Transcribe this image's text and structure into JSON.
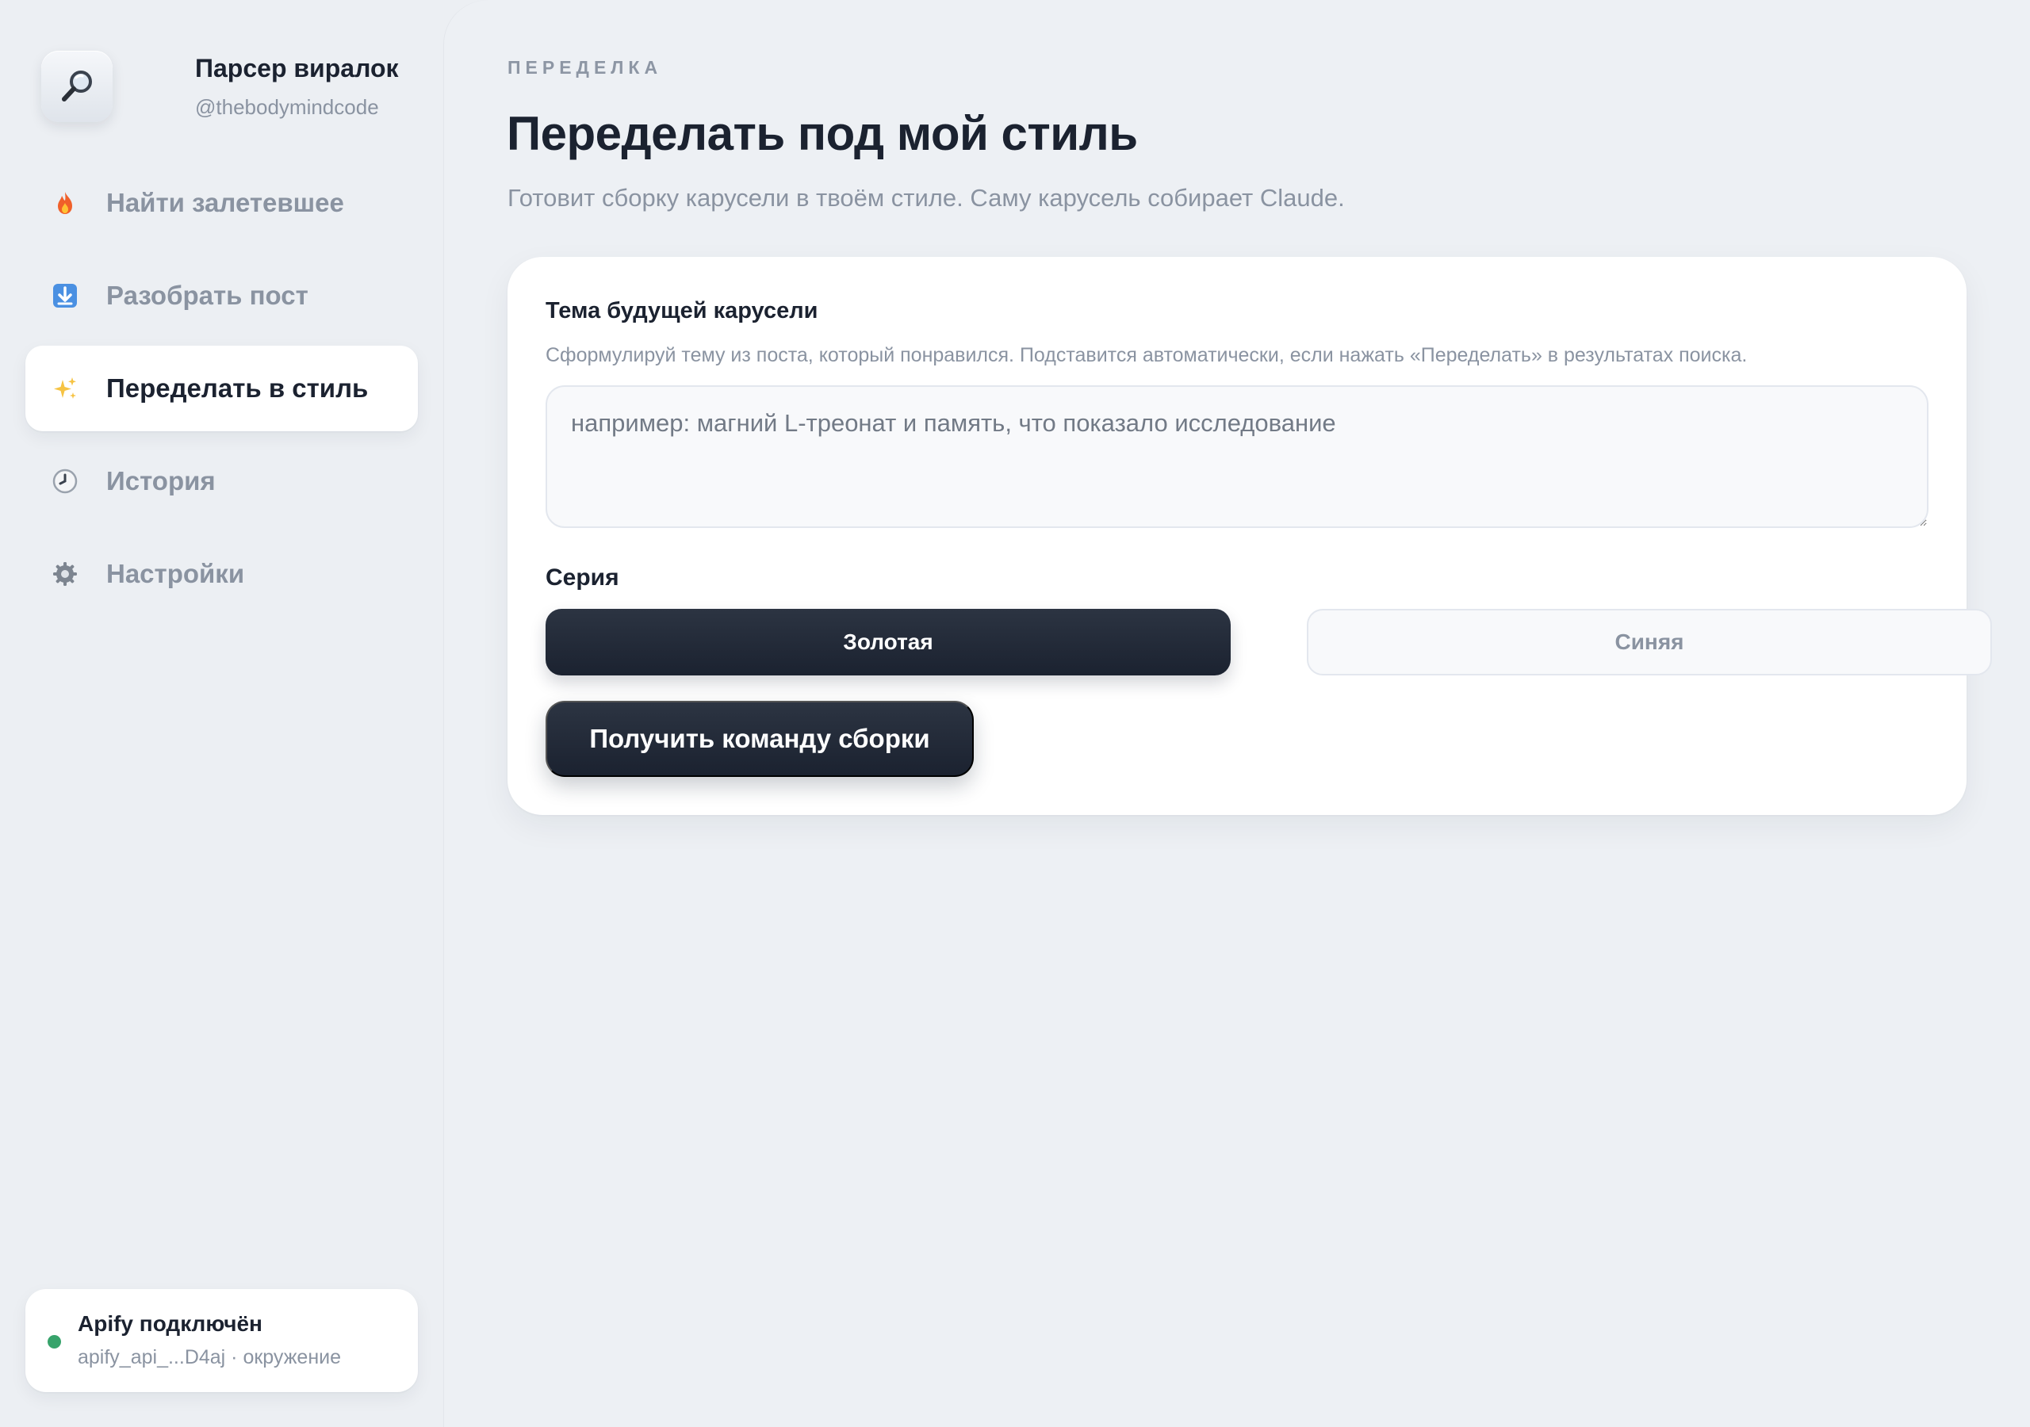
{
  "brand": {
    "title": "Парсер виралок",
    "handle": "@thebodymindcode",
    "logo_icon": "magnifier-icon"
  },
  "sidebar": {
    "items": [
      {
        "label": "Найти залетевшее",
        "icon": "fire-icon",
        "active": false
      },
      {
        "label": "Разобрать пост",
        "icon": "download-arrow-icon",
        "active": false
      },
      {
        "label": "Переделать в стиль",
        "icon": "sparkles-icon",
        "active": true
      },
      {
        "label": "История",
        "icon": "clock-icon",
        "active": false
      },
      {
        "label": "Настройки",
        "icon": "gear-icon",
        "active": false
      }
    ]
  },
  "status": {
    "title": "Apify подключён",
    "subtitle": "apify_api_...D4aj · окружение",
    "color": "#37a36b"
  },
  "main": {
    "eyebrow": "ПЕРЕДЕЛКА",
    "title": "Переделать под мой стиль",
    "subtitle": "Готовит сборку карусели в твоём стиле. Саму карусель собирает Claude."
  },
  "form": {
    "topic_label": "Тема будущей карусели",
    "topic_hint": "Сформулируй тему из поста, который понравился. Подставится автоматически, если нажать «Переделать» в результатах поиска.",
    "topic_value": "",
    "topic_placeholder": "например: магний L-треонат и память, что показало исследование",
    "series_label": "Серия",
    "series_options": [
      {
        "label": "Золотая",
        "selected": true
      },
      {
        "label": "Синяя",
        "selected": false
      }
    ],
    "submit_label": "Получить команду сборки"
  },
  "colors": {
    "accent_dark": "#1b2230",
    "muted_text": "#8a93a1",
    "background": "#eceff3"
  }
}
